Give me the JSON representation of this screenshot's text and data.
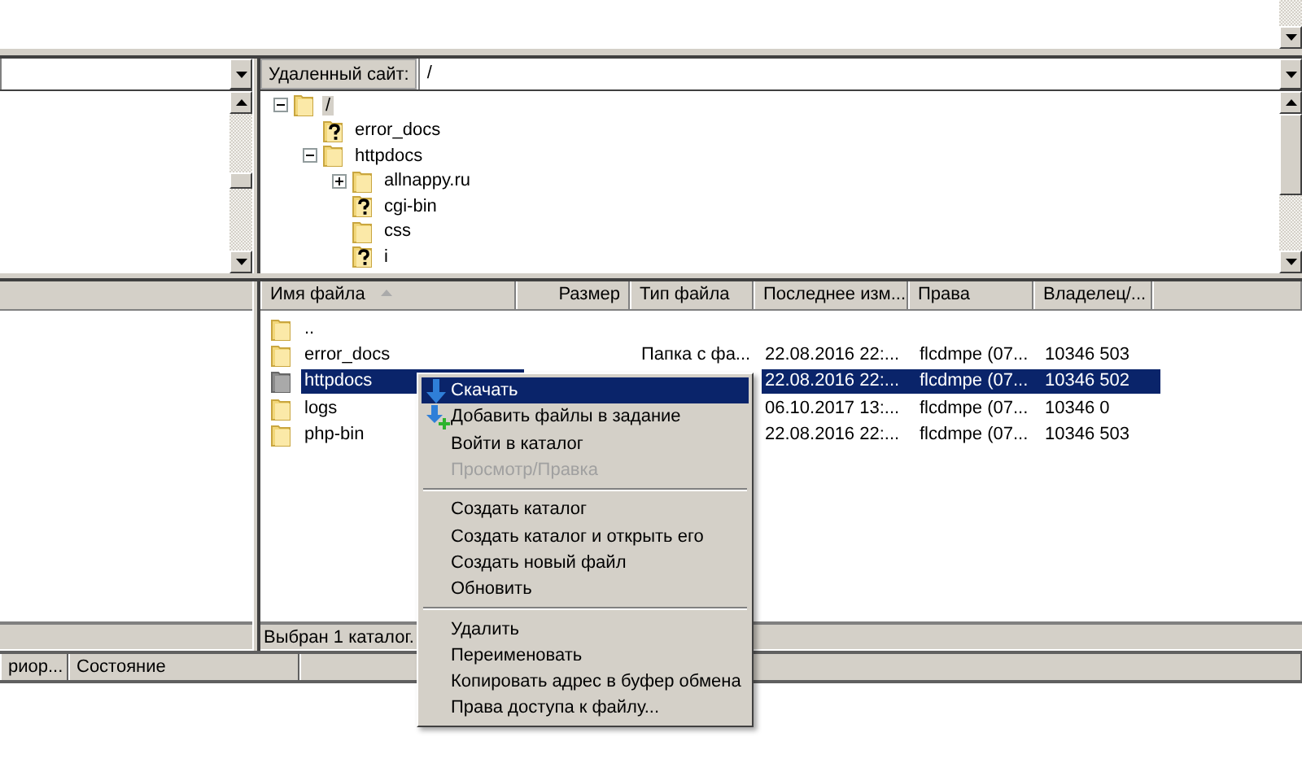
{
  "remote_site": {
    "label": "Удаленный сайт:",
    "path": "/",
    "tree": [
      {
        "name": "/",
        "kind": "folder",
        "expanded": true,
        "selected": true,
        "children": [
          {
            "name": "error_docs",
            "kind": "unknown",
            "selected": false
          },
          {
            "name": "httpdocs",
            "kind": "folder",
            "expanded": true,
            "selected": false,
            "children": [
              {
                "name": "allnappy.ru",
                "kind": "folder",
                "expanded": false,
                "selected": false
              },
              {
                "name": "cgi-bin",
                "kind": "unknown",
                "selected": false
              },
              {
                "name": "css",
                "kind": "folder",
                "selected": false
              },
              {
                "name": "i",
                "kind": "unknown",
                "selected": false
              }
            ]
          }
        ]
      }
    ]
  },
  "file_list": {
    "columns": [
      {
        "label": "Имя файла",
        "sorted": true
      },
      {
        "label": "Размер"
      },
      {
        "label": "Тип файла"
      },
      {
        "label": "Последнее изм..."
      },
      {
        "label": "Права"
      },
      {
        "label": "Владелец/..."
      }
    ],
    "rows": [
      {
        "name": "..",
        "selected": false
      },
      {
        "name": "error_docs",
        "type": "Папка с фа...",
        "modified": "22.08.2016 22:...",
        "permissions": "flcdmpe (07...",
        "owner": "10346 503",
        "selected": false
      },
      {
        "name": "httpdocs",
        "modified": "22.08.2016 22:...",
        "permissions": "flcdmpe (07...",
        "owner": "10346 502",
        "selected": true
      },
      {
        "name": "logs",
        "modified": "06.10.2017 13:...",
        "permissions": "flcdmpe (07...",
        "owner": "10346 0",
        "selected": false
      },
      {
        "name": "php-bin",
        "modified": "22.08.2016 22:...",
        "permissions": "flcdmpe (07...",
        "owner": "10346 503",
        "selected": false
      }
    ],
    "status": "Выбран 1 каталог."
  },
  "queue": {
    "columns": [
      "риор...",
      "Состояние"
    ]
  },
  "context_menu": [
    {
      "kind": "download",
      "label": "Скачать",
      "selected": true,
      "disabled": false
    },
    {
      "kind": "enqueue",
      "label": "Добавить файлы в задание",
      "selected": false,
      "disabled": false
    },
    {
      "kind": "item",
      "label": "Войти в каталог",
      "selected": false,
      "disabled": false
    },
    {
      "kind": "item",
      "label": "Просмотр/Правка",
      "selected": false,
      "disabled": true
    },
    {
      "kind": "separator"
    },
    {
      "kind": "item",
      "label": "Создать каталог",
      "selected": false,
      "disabled": false
    },
    {
      "kind": "item",
      "label": "Создать каталог и открыть его",
      "selected": false,
      "disabled": false
    },
    {
      "kind": "item",
      "label": "Создать новый файл",
      "selected": false,
      "disabled": false
    },
    {
      "kind": "item",
      "label": "Обновить",
      "selected": false,
      "disabled": false
    },
    {
      "kind": "separator"
    },
    {
      "kind": "item",
      "label": "Удалить",
      "selected": false,
      "disabled": false
    },
    {
      "kind": "item",
      "label": "Переименовать",
      "selected": false,
      "disabled": false
    },
    {
      "kind": "item",
      "label": "Копировать адрес в буфер обмена",
      "selected": false,
      "disabled": false
    },
    {
      "kind": "item",
      "label": "Права доступа к файлу...",
      "selected": false,
      "disabled": false
    }
  ]
}
